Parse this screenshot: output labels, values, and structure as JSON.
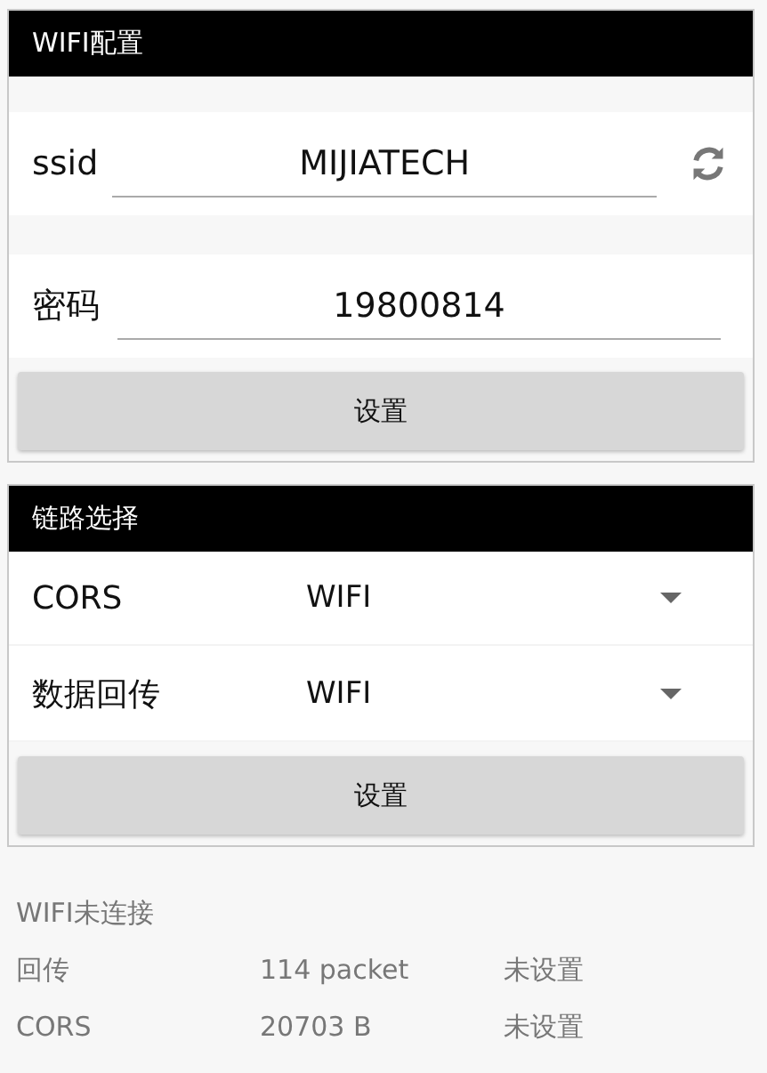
{
  "wifi_panel": {
    "title": "WIFI配置",
    "ssid": {
      "label": "ssid",
      "value": "MIJIATECH"
    },
    "password": {
      "label": "密码",
      "value": "19800814"
    },
    "button": "设置"
  },
  "link_panel": {
    "title": "链路选择",
    "selects": [
      {
        "label": "CORS",
        "value": "WIFI"
      },
      {
        "label": "数据回传",
        "value": "WIFI"
      }
    ],
    "button": "设置"
  },
  "status": {
    "message": "WIFI未连接",
    "rows": [
      {
        "name": "回传",
        "amount": "114 packet",
        "state": "未设置"
      },
      {
        "name": "CORS",
        "amount": "20703 B",
        "state": "未设置"
      }
    ]
  }
}
